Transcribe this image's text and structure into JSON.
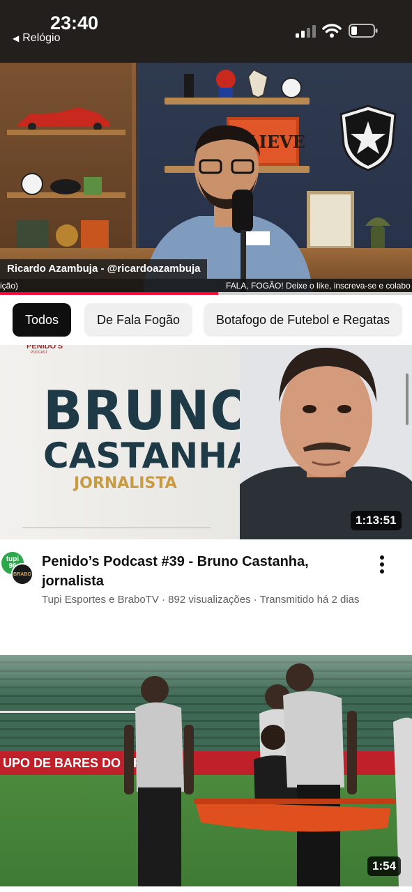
{
  "status_bar": {
    "time": "23:40",
    "back_label": "Relógio",
    "icons": [
      "cellular-signal-icon",
      "wifi-icon",
      "battery-icon"
    ]
  },
  "player": {
    "lower_third_name": "Ricardo Azambuja - @ricardoazambuja",
    "ticker_left": "ição)",
    "ticker_right": "FALA, FOGÃO! Deixe o like, inscreva-se e colabo",
    "sign_text": "BELIEVE",
    "progress_fraction": 0.53
  },
  "chips": [
    {
      "label": "Todos",
      "selected": true
    },
    {
      "label": "De Fala Fogão",
      "selected": false
    },
    {
      "label": "Botafogo de Futebol e Regatas",
      "selected": false
    }
  ],
  "videos": [
    {
      "thumbnail": {
        "brand": "PENIDO'S",
        "brand_sub": "PODCAST",
        "line1": "BRUNO",
        "line2": "CASTANHA",
        "line3": "JORNALISTA"
      },
      "duration": "1:13:51",
      "title": "Penido’s Podcast #39 - Bruno Castanha, jornalista",
      "subtitle": "Tupi Esportes e BraboTV · 892 visualizações · Transmitido há 2 dias",
      "avatar_a": "tupi 96",
      "avatar_b": "BRABO"
    },
    {
      "thumbnail": {
        "adboard": "UPO DE BARES DO BRASIL"
      },
      "duration": "1:54"
    }
  ],
  "colors": {
    "accent": "#ff0033",
    "chip_active_bg": "#0f0f0f",
    "chip_bg": "#f0f0f0",
    "secondary_text": "#606060"
  }
}
